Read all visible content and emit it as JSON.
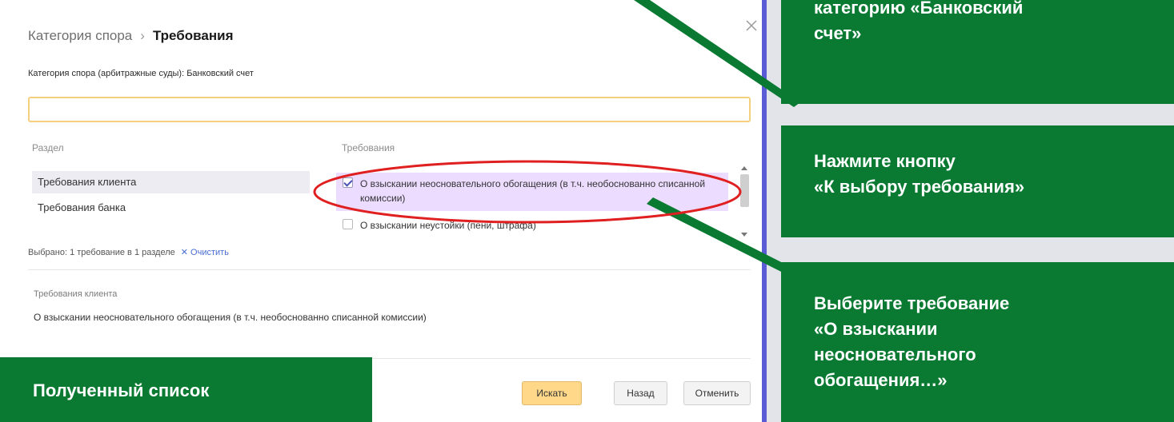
{
  "dialog": {
    "breadcrumb": {
      "parent": "Категория спора",
      "separator": "›",
      "current": "Требования"
    },
    "category_line": "Категория спора (арбитражные суды): Банковский счет",
    "search": {
      "value": "",
      "placeholder": ""
    },
    "columns": {
      "section": "Раздел",
      "requirements": "Требования"
    },
    "sections": [
      {
        "label": "Требования клиента",
        "selected": true
      },
      {
        "label": "Требования банка",
        "selected": false
      }
    ],
    "requirements": [
      {
        "label": "О взыскании неосновательного обогащения (в т.ч. необоснованно списанной комиссии)",
        "checked": true
      },
      {
        "label": "О взыскании неустойки (пени, штрафа)",
        "checked": false
      }
    ],
    "selected_summary": "Выбрано: 1 требование в 1 разделе",
    "clear_label": "✕ Очистить",
    "chosen": {
      "section_title": "Требования клиента",
      "value": "О взыскании неосновательного обогащения (в т.ч. необоснованно списанной комиссии)"
    },
    "buttons": {
      "search": "Искать",
      "back": "Назад",
      "cancel": "Отменить"
    }
  },
  "annotations": {
    "top": "категорию «Банковский\nсчет»",
    "middle": "Нажмите кнопку\n«К выбору требования»",
    "bottom": "Выберите требование\n«О взыскании\nнеосновательного\nобогащения…»",
    "left": "Полученный список"
  },
  "colors": {
    "accent_green": "#0a7a32",
    "highlight_red": "#e02020",
    "selection_purple": "#ecdcff",
    "primary_button": "#ffd88a",
    "dialog_border": "#5b5bd6"
  }
}
